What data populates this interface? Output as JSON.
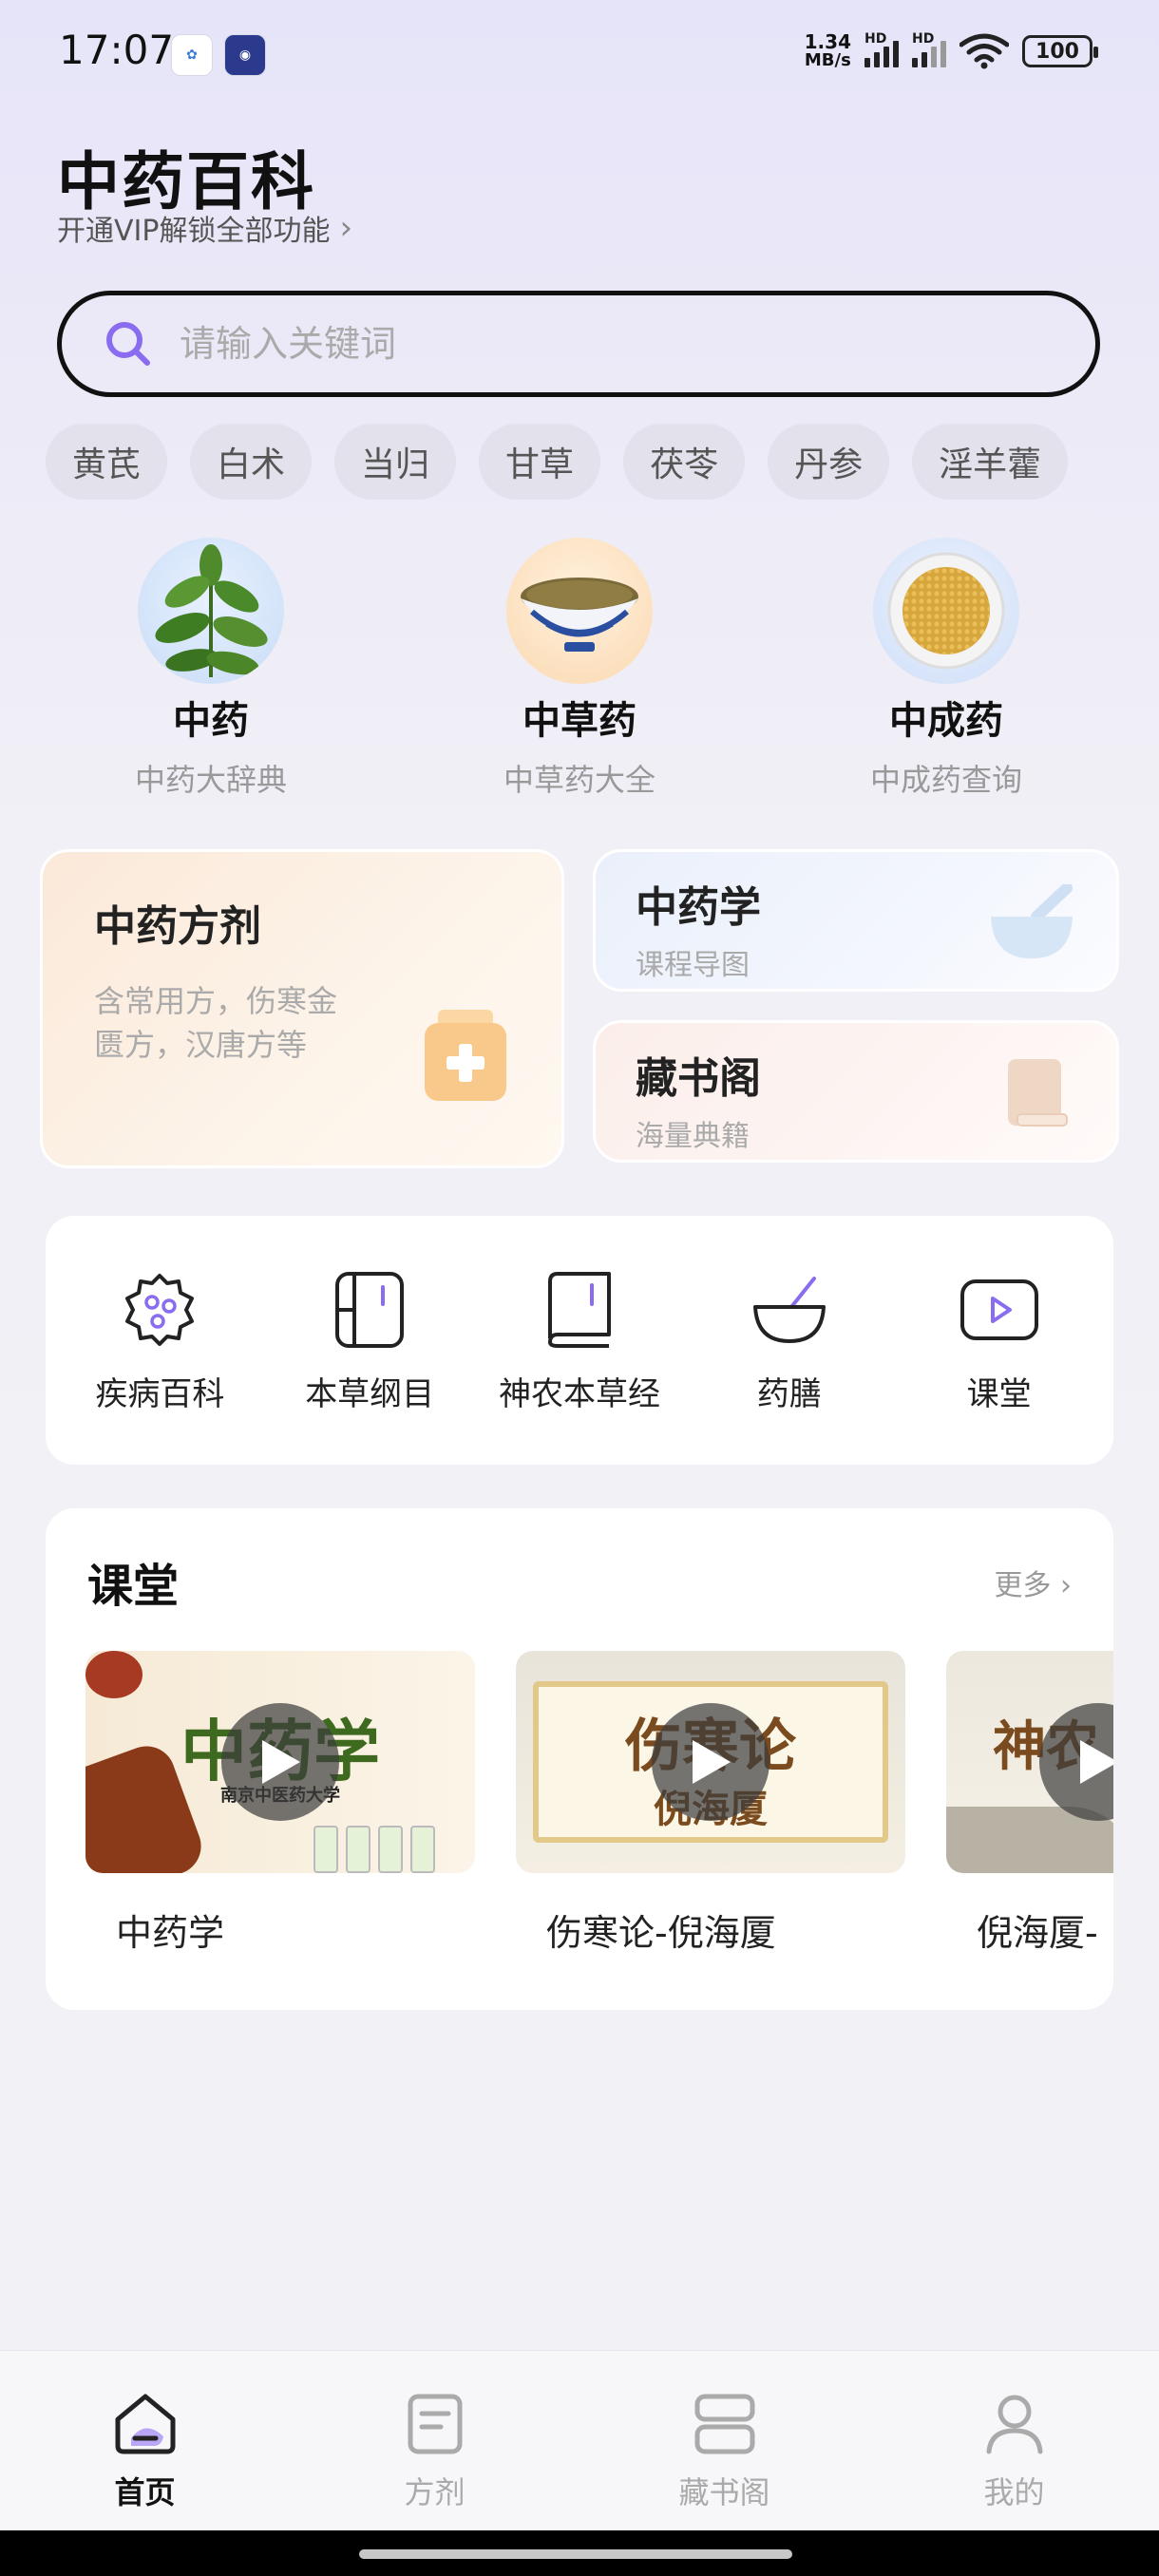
{
  "status": {
    "time": "17:07",
    "net_speed_value": "1.34",
    "net_speed_unit": "MB/s",
    "hd": "HD",
    "battery": "100"
  },
  "header": {
    "title": "中药百科",
    "vip_text": "开通VIP解锁全部功能"
  },
  "search": {
    "placeholder": "请输入关键词"
  },
  "chips": [
    "黄芪",
    "白术",
    "当归",
    "甘草",
    "茯苓",
    "丹参",
    "淫羊藿"
  ],
  "categories": [
    {
      "name": "中药",
      "sub": "中药大辞典"
    },
    {
      "name": "中草药",
      "sub": "中草药大全"
    },
    {
      "name": "中成药",
      "sub": "中成药查询"
    }
  ],
  "features": {
    "fangji": {
      "title": "中药方剂",
      "desc": "含常用方，伤寒金匮方，汉唐方等"
    },
    "zhongyaoxue": {
      "title": "中药学",
      "desc": "课程导图"
    },
    "cangshuge": {
      "title": "藏书阁",
      "desc": "海量典籍"
    }
  },
  "tools": [
    "疾病百科",
    "本草纲目",
    "神农本草经",
    "药膳",
    "课堂"
  ],
  "course": {
    "title": "课堂",
    "more": "更多",
    "items": [
      {
        "caption": "中药学",
        "thumb_title": "中药学",
        "thumb_sub": "南京中医药大学"
      },
      {
        "caption": "伤寒论-倪海厦",
        "thumb_title": "伤寒论",
        "thumb_sub": "倪海厦"
      },
      {
        "caption": "倪海厦-",
        "thumb_title": "神农",
        "thumb_sub": ""
      }
    ]
  },
  "tabs": [
    "首页",
    "方剂",
    "藏书阁",
    "我的"
  ],
  "colors": {
    "accent": "#8a6cf0",
    "orange": "#f8c88e"
  }
}
